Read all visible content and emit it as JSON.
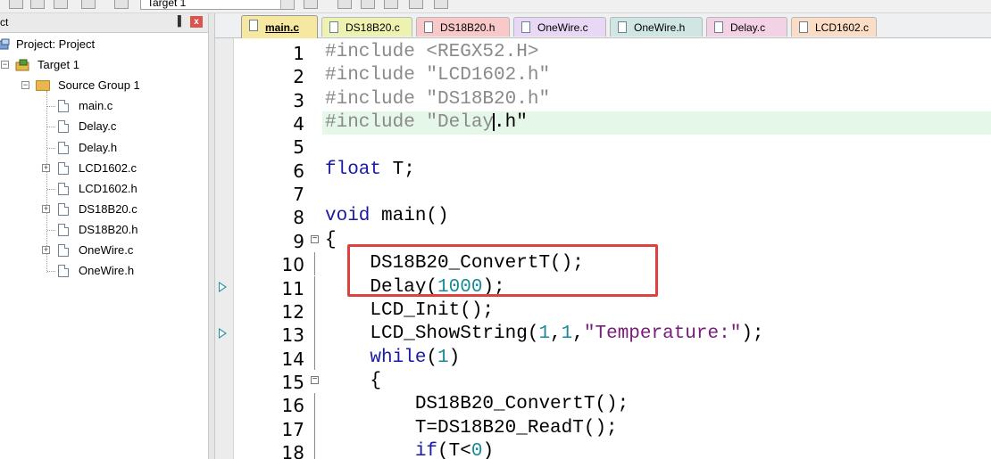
{
  "toolbar": {
    "target_combo_value": "Target 1"
  },
  "project_panel": {
    "title": "ct",
    "pin_glyph": "▐",
    "close_glyph": "x",
    "tree": [
      {
        "label": "Project: Project",
        "kind": "project"
      },
      {
        "label": "Target 1",
        "kind": "target"
      },
      {
        "label": "Source Group 1",
        "kind": "group"
      },
      {
        "label": "main.c",
        "kind": "file",
        "expandable": false
      },
      {
        "label": "Delay.c",
        "kind": "file",
        "expandable": false
      },
      {
        "label": "Delay.h",
        "kind": "file",
        "expandable": false
      },
      {
        "label": "LCD1602.c",
        "kind": "file",
        "expandable": true
      },
      {
        "label": "LCD1602.h",
        "kind": "file",
        "expandable": false
      },
      {
        "label": "DS18B20.c",
        "kind": "file",
        "expandable": true
      },
      {
        "label": "DS18B20.h",
        "kind": "file",
        "expandable": false
      },
      {
        "label": "OneWire.c",
        "kind": "file",
        "expandable": true
      },
      {
        "label": "OneWire.h",
        "kind": "file",
        "expandable": false
      }
    ]
  },
  "tabs": [
    {
      "label": "main.c",
      "active": true,
      "color": "#f6e7a1"
    },
    {
      "label": "DS18B20.c",
      "active": false,
      "color": "#eef2b0"
    },
    {
      "label": "DS18B20.h",
      "active": false,
      "color": "#f9c9c9"
    },
    {
      "label": "OneWire.c",
      "active": false,
      "color": "#e9d8f5"
    },
    {
      "label": "OneWire.h",
      "active": false,
      "color": "#cfe6e3"
    },
    {
      "label": "Delay.c",
      "active": false,
      "color": "#f4d2e6"
    },
    {
      "label": "LCD1602.c",
      "active": false,
      "color": "#fbdcc4"
    }
  ],
  "code_lines": [
    {
      "num": "1",
      "text": "#include <REGX52.H>"
    },
    {
      "num": "2",
      "text": "#include \"LCD1602.h\""
    },
    {
      "num": "3",
      "text": "#include \"DS18B20.h\""
    },
    {
      "num": "4",
      "text": "#include \"Delay.h\""
    },
    {
      "num": "5",
      "text": ""
    },
    {
      "num": "6",
      "text": "float T;"
    },
    {
      "num": "7",
      "text": ""
    },
    {
      "num": "8",
      "text": "void main()"
    },
    {
      "num": "9",
      "text": "{"
    },
    {
      "num": "10",
      "text": "    DS18B20_ConvertT();"
    },
    {
      "num": "11",
      "text": "    Delay(1000);"
    },
    {
      "num": "12",
      "text": "    LCD_Init();"
    },
    {
      "num": "13",
      "text": "    LCD_ShowString(1,1,\"Temperature:\");"
    },
    {
      "num": "14",
      "text": "    while(1)"
    },
    {
      "num": "15",
      "text": "    {"
    },
    {
      "num": "16",
      "text": "        DS18B20_ConvertT();"
    },
    {
      "num": "17",
      "text": "        T=DS18B20_ReadT();"
    },
    {
      "num": "18",
      "text": "        if(T<0)"
    }
  ],
  "colors": {
    "preprocessor": "#8a8a8a",
    "keyword": "#1a1aa6",
    "string": "#7a1a7a",
    "number": "#1a8a9a",
    "current_line": "#e5f7e8",
    "annotation_box": "#e0413f",
    "arrow": "#1f8fa0"
  },
  "editor_state": {
    "current_line": "4",
    "caret_line": "4",
    "fold_markers": [
      "9",
      "15"
    ],
    "arrow_markers": [
      "11",
      "13"
    ],
    "annotated_lines": [
      "10",
      "11"
    ]
  }
}
